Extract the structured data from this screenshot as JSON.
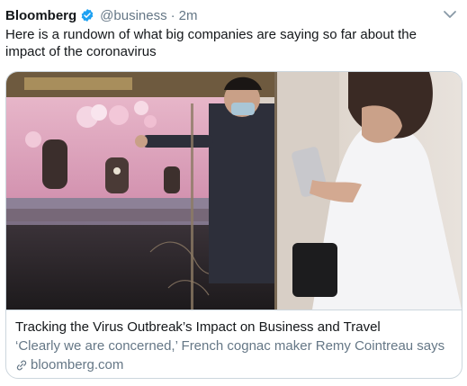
{
  "tweet": {
    "author_name": "Bloomberg",
    "handle": "@business",
    "separator": "·",
    "time": "2m",
    "text": "Here is a rundown of what big companies are saying so far about the impact of the coronavirus"
  },
  "card": {
    "title": "Tracking the Virus Outbreak’s Impact on Business and Travel",
    "description": "‘Clearly we are concerned,’ French cognac maker Remy Cointreau says",
    "domain": "bloomberg.com"
  },
  "icons": {
    "verified": "verified-badge-icon",
    "menu": "chevron-down-icon",
    "link": "link-icon"
  },
  "colors": {
    "verified_blue": "#1da1f2",
    "secondary_text": "#657786",
    "border": "#ccd6dd"
  }
}
